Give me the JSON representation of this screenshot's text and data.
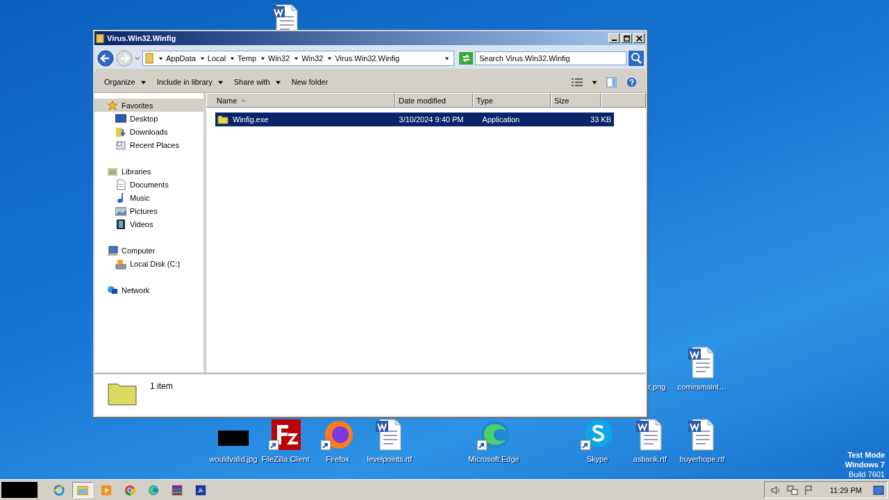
{
  "desktop": {
    "icons": [
      {
        "kind": "word"
      },
      {
        "label": "z.png"
      },
      {
        "kind": "word",
        "label": "comesmaint…"
      },
      {
        "kind": "blackimage",
        "label": "wouldvalid.jpg"
      },
      {
        "kind": "filezilla",
        "label": "FileZilla Client",
        "shortcut": true
      },
      {
        "kind": "firefox",
        "label": "Firefox",
        "shortcut": true
      },
      {
        "kind": "word",
        "label": "levelpoints.rtf"
      },
      {
        "kind": "edge",
        "label": "Microsoft Edge",
        "shortcut": true
      },
      {
        "kind": "skype",
        "label": "Skype",
        "shortcut": true
      },
      {
        "kind": "word",
        "label": "asbank.rtf"
      },
      {
        "kind": "word",
        "label": "buyerhope.rtf"
      }
    ],
    "mode_text": [
      "Test Mode",
      "Windows 7",
      "Build 7601"
    ]
  },
  "window": {
    "title": "Virus.Win32.Winfig",
    "breadcrumb": [
      "AppData",
      "Local",
      "Temp",
      "Win32",
      "Win32",
      "Virus.Win32.Winfig"
    ],
    "search": {
      "placeholder": "Search Virus.Win32.Winfig"
    },
    "toolbar": [
      {
        "label": "Organize",
        "has_menu": true
      },
      {
        "label": "Include in library",
        "has_menu": true
      },
      {
        "label": "Share with",
        "has_menu": true
      },
      {
        "label": "New folder",
        "has_menu": false
      }
    ],
    "sidebar": [
      {
        "label": "Favorites",
        "selected": true,
        "children": [
          {
            "label": "Desktop",
            "selected": false
          },
          {
            "label": "Downloads",
            "selected": false
          },
          {
            "label": "Recent Places",
            "selected": false
          }
        ]
      },
      {
        "label": "Libraries",
        "selected": false,
        "children": [
          {
            "label": "Documents",
            "selected": false
          },
          {
            "label": "Music",
            "selected": false
          },
          {
            "label": "Pictures",
            "selected": false
          },
          {
            "label": "Videos",
            "selected": false
          }
        ]
      },
      {
        "label": "Computer",
        "selected": false,
        "children": [
          {
            "label": "Local Disk (C:)",
            "selected": false
          }
        ]
      },
      {
        "label": "Network",
        "selected": false
      }
    ],
    "table": {
      "columns": [
        {
          "label": "Name",
          "sorted": true
        },
        {
          "label": "Date modified",
          "sorted": false
        },
        {
          "label": "Type",
          "sorted": false
        },
        {
          "label": "Size",
          "sorted": false
        }
      ],
      "rows": [
        {
          "name": "Winfig.exe",
          "date": "3/10/2024 9:40 PM",
          "type": "Application",
          "size": "33 KB",
          "selected": true
        }
      ]
    },
    "status_bar": {
      "text": "1 item"
    }
  },
  "taskbar": {
    "buttons": [
      {
        "kind": "ie",
        "selected": false
      },
      {
        "kind": "explorer",
        "selected": true
      },
      {
        "kind": "media",
        "selected": false
      },
      {
        "kind": "chrome",
        "selected": false
      },
      {
        "kind": "edge",
        "selected": false
      },
      {
        "kind": "winrar",
        "selected": false
      },
      {
        "kind": "app",
        "selected": false
      }
    ],
    "time": "11:29 PM"
  }
}
